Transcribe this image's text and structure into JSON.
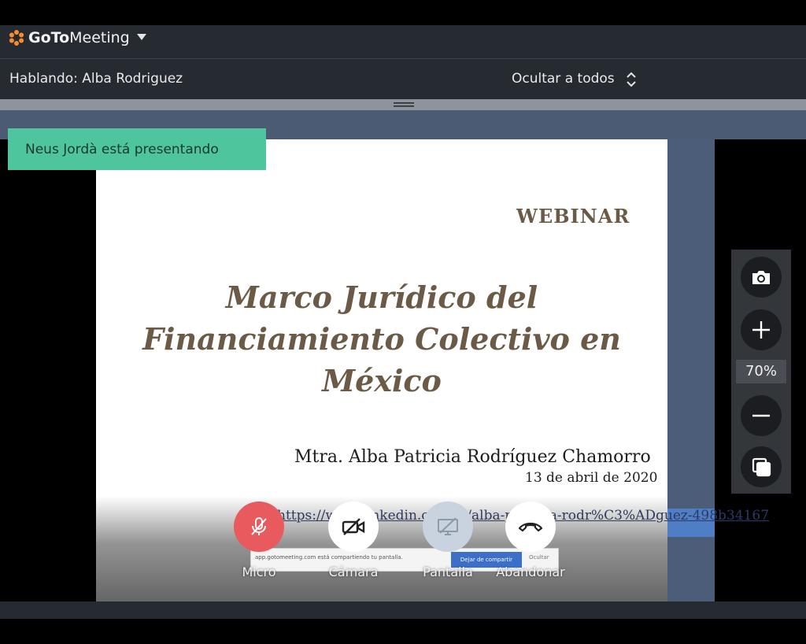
{
  "app": {
    "brand_bold": "GoTo",
    "brand_rest": "Meeting",
    "logo_icon": "gotomeeting-logo-icon",
    "menu_icon": "caret-down-icon"
  },
  "speaker_bar": {
    "speaking": "Hablando: Alba Rodriguez",
    "hide_all": "Ocultar a todos",
    "hide_all_icon": "expand-collapse-icon"
  },
  "presenter": {
    "banner": "Neus Jordà está presentando"
  },
  "slide": {
    "tag": "WEBINAR",
    "title_lines": [
      "Marco Jurídico del",
      "Financiamiento Colectivo en",
      "México"
    ],
    "author": "Mtra. Alba Patricia Rodríguez Chamorro",
    "date": "13 de abril de 2020",
    "link": "https://www.linkedin.com/in/alba-patricia-rodr%C3%ADguez-498b34167",
    "share_notice": "app.gotomeeting.com está compartiendo tu pantalla.",
    "stop_share": "Dejar de compartir",
    "hide_notice": "Ocultar"
  },
  "controls": [
    {
      "label": "Micro",
      "icon": "mic-off-icon",
      "state": "muted",
      "color": "#e95a5f"
    },
    {
      "label": "Cámara",
      "icon": "camera-off-icon",
      "state": "off",
      "color": "#ffffff"
    },
    {
      "label": "Pantalla",
      "icon": "screen-share-icon",
      "state": "disabled",
      "color": "#c9d2df"
    },
    {
      "label": "Abandonar",
      "icon": "hang-up-icon",
      "state": "normal",
      "color": "#ffffff"
    }
  ],
  "zoom": {
    "level": "70%",
    "snapshot_icon": "camera-icon",
    "zoom_in_icon": "plus-icon",
    "zoom_out_icon": "minus-icon",
    "popout_icon": "popout-window-icon"
  },
  "colors": {
    "banner": "#4fc59e",
    "mic_muted": "#e95a5f",
    "bar_bg": "#262a31",
    "side_panel": "#4c5d79",
    "slide_text": "#6b5b46"
  }
}
